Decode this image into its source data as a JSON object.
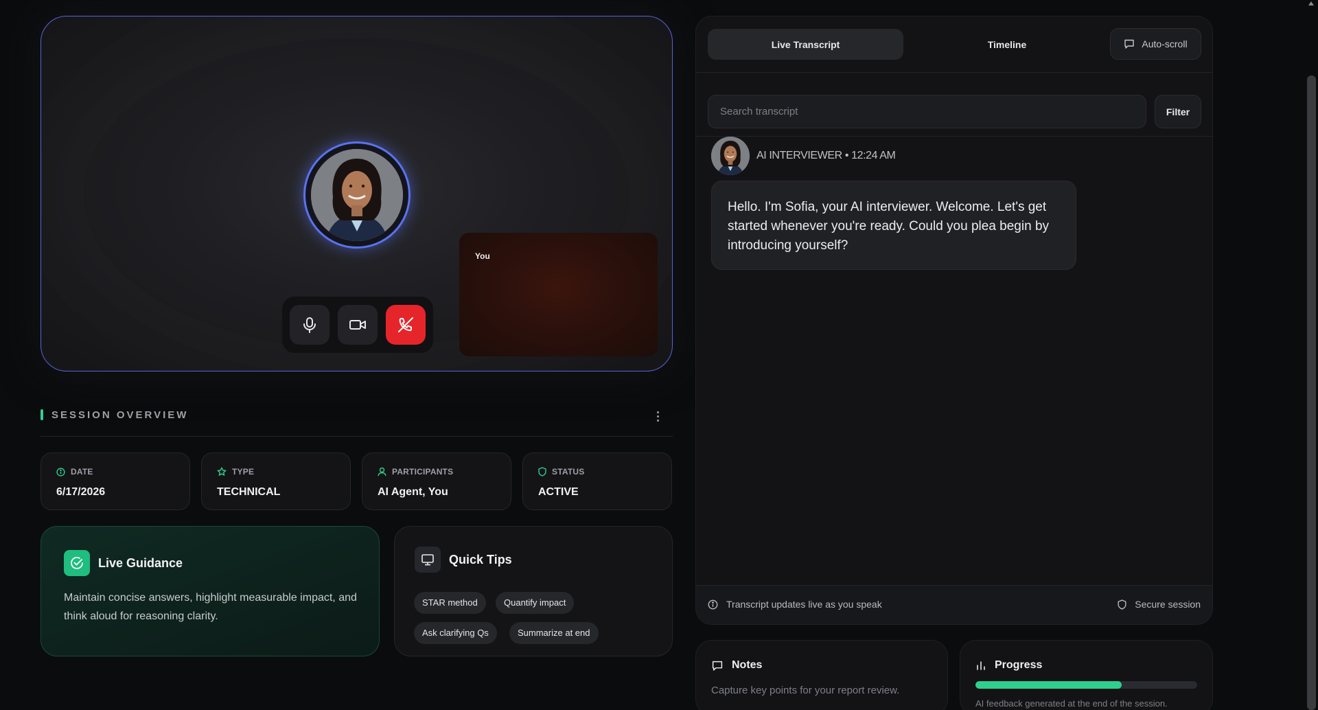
{
  "stage": {
    "self_label": "You",
    "controls": {
      "mic": "microphone-icon",
      "camera": "camera-icon",
      "end": "end-call-icon"
    }
  },
  "overview": {
    "title": "SESSION OVERVIEW",
    "cards": [
      {
        "label": "DATE",
        "value": "6/17/2026",
        "icon": "info-icon"
      },
      {
        "label": "TYPE",
        "value": "TECHNICAL",
        "icon": "star-icon"
      },
      {
        "label": "PARTICIPANTS",
        "value": "AI Agent, You",
        "icon": "user-icon"
      },
      {
        "label": "STATUS",
        "value": "ACTIVE",
        "icon": "shield-icon"
      }
    ]
  },
  "guidance": {
    "title": "Live Guidance",
    "body": "Maintain concise answers, highlight measurable impact, and think aloud for reasoning clarity."
  },
  "tips": {
    "title": "Quick Tips",
    "chips": [
      "STAR method",
      "Quantify impact",
      "Ask clarifying Qs",
      "Summarize at end"
    ]
  },
  "transcript": {
    "tabs": [
      "Live Transcript",
      "Timeline"
    ],
    "autoscroll_label": "Auto-scroll",
    "search_placeholder": "Search transcript",
    "filter_label": "Filter",
    "message": {
      "meta": "AI INTERVIEWER • 12:24 AM",
      "text": "Hello. I'm Sofia, your AI interviewer. Welcome. Let's get started whenever you're ready. Could you plea begin by introducing yourself?"
    },
    "footer_left": "Transcript updates live as you speak",
    "footer_right": "Secure session"
  },
  "notes": {
    "title": "Notes",
    "subtitle": "Capture key points for your report review."
  },
  "progress": {
    "title": "Progress",
    "value_fraction": 0.66,
    "subtitle": "AI feedback generated at the end of the session."
  },
  "colors": {
    "accent_green": "#2fd08e",
    "stage_border": "#5a63d8",
    "end_call_red": "#e5252a"
  }
}
